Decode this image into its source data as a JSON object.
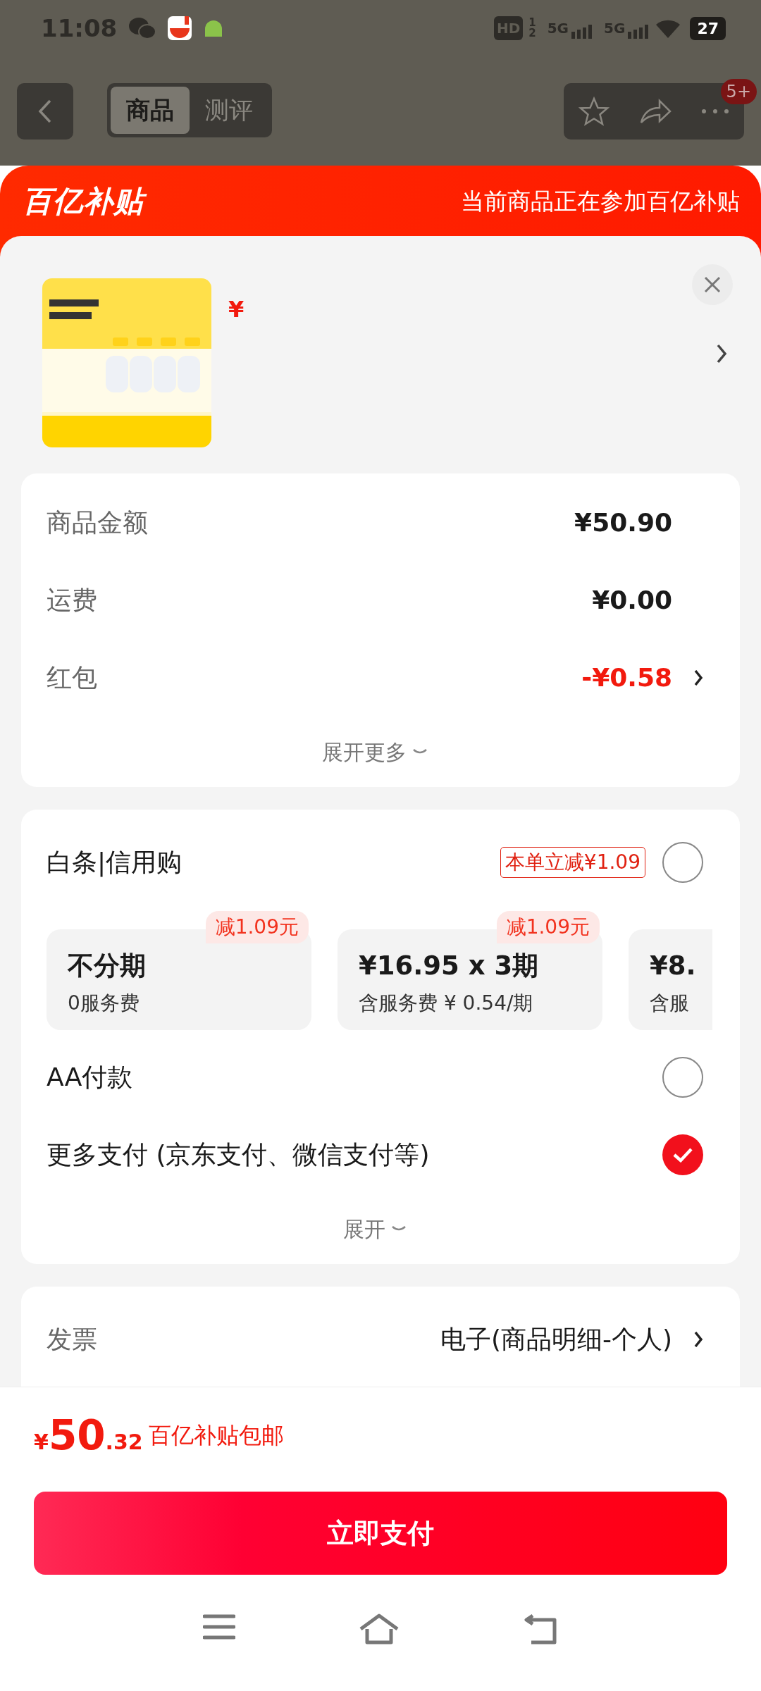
{
  "status_bar": {
    "time": "11:08",
    "hd_label": "HD",
    "sim_labels": [
      "1",
      "2"
    ],
    "network_labels": [
      "5G",
      "5G"
    ],
    "battery": "27"
  },
  "header": {
    "tabs": [
      {
        "label": "商品",
        "selected": true
      },
      {
        "label": "测评",
        "selected": false
      }
    ],
    "badge": "5+"
  },
  "banner": {
    "logo": "百亿补贴",
    "message": "当前商品正在参加百亿补贴"
  },
  "product": {
    "price_prefix": "¥"
  },
  "summary": {
    "rows": [
      {
        "label": "商品金额",
        "value": "¥50.90",
        "kind": "plain"
      },
      {
        "label": "运费",
        "value": "¥0.00",
        "kind": "plain"
      },
      {
        "label": "红包",
        "value": "-¥0.58",
        "kind": "discount"
      }
    ],
    "expand": "展开更多"
  },
  "payment": {
    "methods": [
      {
        "kind": "credit",
        "label": "白条|信用购",
        "tag": "本单立减¥1.09",
        "selected": false,
        "plans": [
          {
            "title": "不分期",
            "subtitle": "0服务费",
            "tag": "减1.09元"
          },
          {
            "title": "¥16.95 x 3期",
            "subtitle": "含服务费 ¥ 0.54/期",
            "tag": "减1.09元"
          },
          {
            "title": "¥8.",
            "subtitle": "含服"
          }
        ]
      },
      {
        "kind": "plain",
        "label": "AA付款",
        "selected": false
      },
      {
        "kind": "plain",
        "label": "更多支付 (京东支付、微信支付等)",
        "selected": true
      }
    ],
    "expand": "展开"
  },
  "invoice": {
    "label": "发票",
    "value": "电子(商品明细-个人)"
  },
  "footer": {
    "currency": "¥",
    "price_int": "50",
    "price_dec": ".32",
    "note": "百亿补贴包邮",
    "pay_button": "立即支付"
  }
}
